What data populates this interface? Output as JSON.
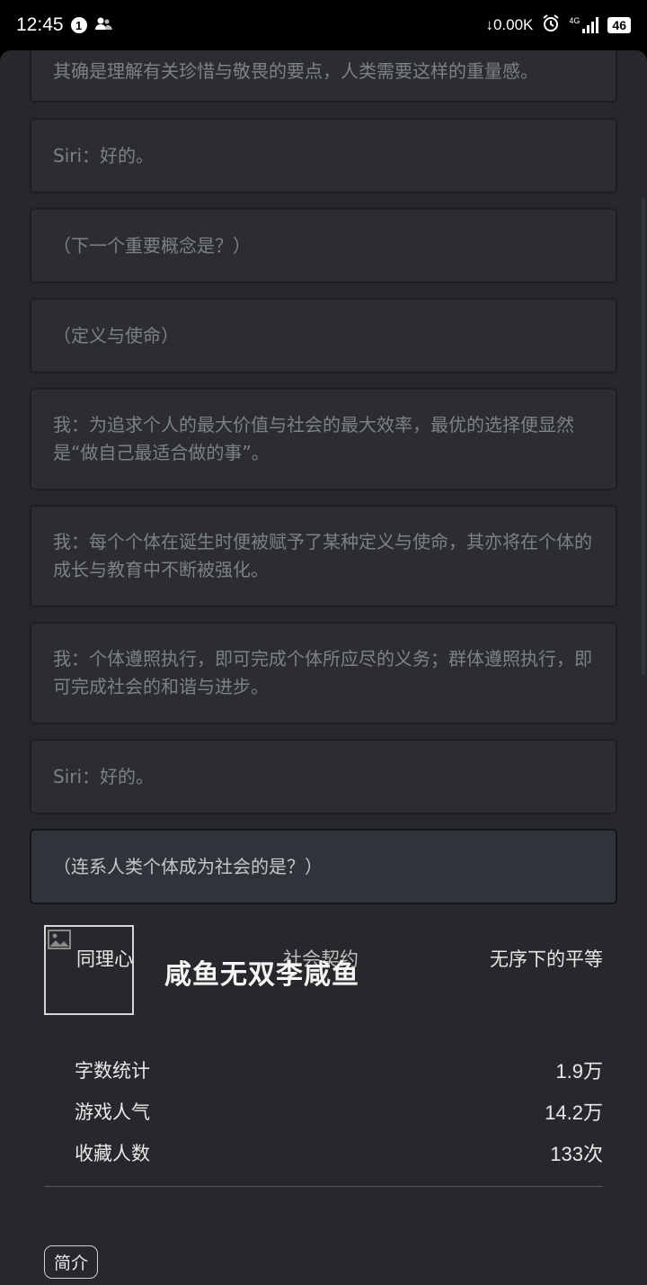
{
  "statusbar": {
    "time": "12:45",
    "notification_count": "1",
    "net_speed": "↓0.00K",
    "network": "4G",
    "battery": "46"
  },
  "messages": [
    "其确是理解有关珍惜与敬畏的要点，人类需要这样的重量感。",
    "Siri：好的。",
    "（下一个重要概念是？）",
    "（定义与使命）",
    "我：为追求个人的最大价值与社会的最大效率，最优的选择便显然是“做自己最适合做的事”。",
    "我：每个个体在诞生时便被赋予了某种定义与使命，其亦将在个体的成长与教育中不断被强化。",
    "我：个体遵照执行，即可完成个体所应尽的义务；群体遵照执行，即可完成社会的和谐与进步。",
    "Siri：好的。",
    "（连系人类个体成为社会的是？）"
  ],
  "options": [
    "同理心",
    "社会契约",
    "无序下的平等"
  ],
  "book": {
    "title": "咸鱼无双李咸鱼"
  },
  "stats": [
    {
      "label": "字数统计",
      "value": "1.9万"
    },
    {
      "label": "游戏人气",
      "value": "14.2万"
    },
    {
      "label": "收藏人数",
      "value": "133次"
    }
  ],
  "intro_label": "简介"
}
